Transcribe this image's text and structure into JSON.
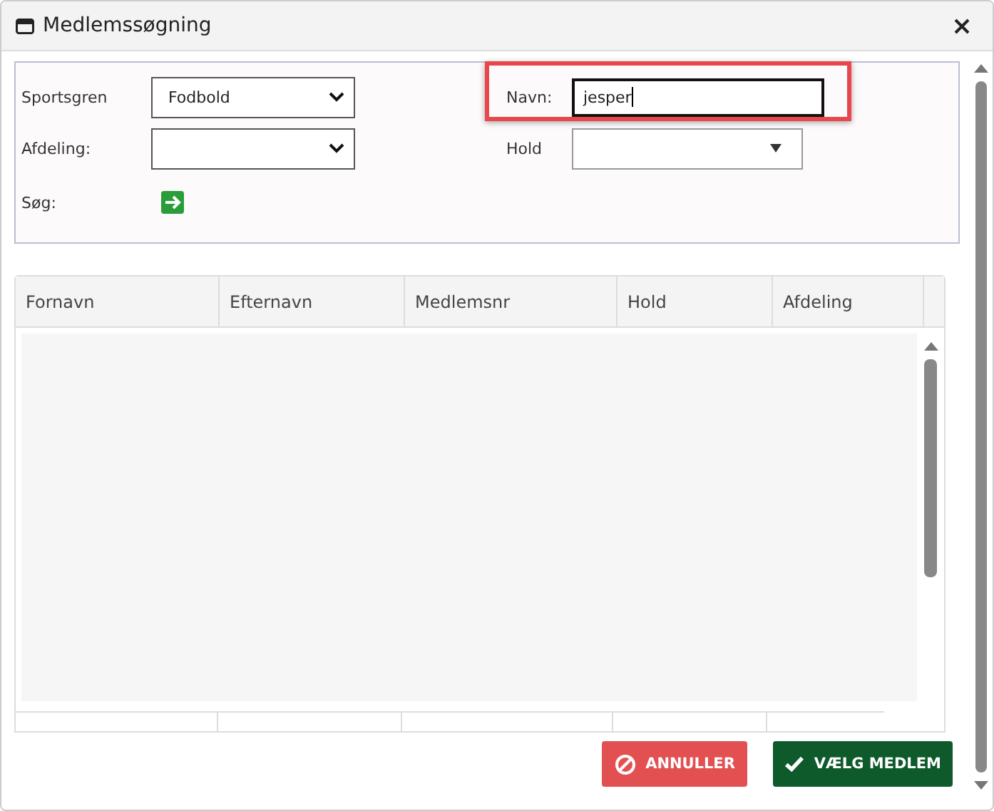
{
  "window": {
    "title": "Medlemssøgning"
  },
  "filters": [
    {
      "kind": "select",
      "label": "Sportsgren",
      "value": "Fodbold"
    },
    {
      "kind": "text",
      "label": "Navn:",
      "value": "jesper",
      "highlighted": true
    },
    {
      "kind": "select",
      "label": "Afdeling:"
    },
    {
      "kind": "combo",
      "label": "Hold"
    },
    {
      "kind": "go",
      "label": "Søg:"
    }
  ],
  "table": {
    "columns": [
      "Fornavn",
      "Efternavn",
      "Medlemsnr",
      "Hold",
      "Afdeling"
    ]
  },
  "buttons": [
    {
      "kind": "cancel",
      "label": "ANNULLER"
    },
    {
      "kind": "confirm",
      "label": "VÆLG MEDLEM"
    }
  ]
}
